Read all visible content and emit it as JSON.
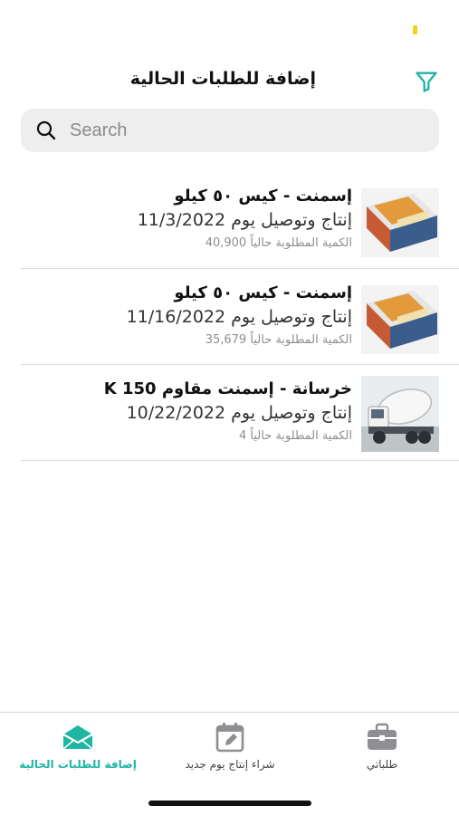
{
  "header": {
    "title": "إضافة للطلبات الحالية"
  },
  "search": {
    "placeholder": "Search",
    "value": ""
  },
  "orders": [
    {
      "title": "إسمنت - كيس ٥٠ كيلو",
      "date_prefix": "إنتاج وتوصيل يوم",
      "date": "11/3/2022",
      "qty_label": "الكمية المطلوبة حالياً",
      "qty": "40,900",
      "image": "cement-bag"
    },
    {
      "title": "إسمنت - كيس ٥٠ كيلو",
      "date_prefix": "إنتاج وتوصيل يوم",
      "date": "11/16/2022",
      "qty_label": "الكمية المطلوبة حالياً",
      "qty": "35,679",
      "image": "cement-bag"
    },
    {
      "title": "خرسانة - إسمنت مقاوم K 150",
      "date_prefix": "إنتاج وتوصيل يوم",
      "date": "10/22/2022",
      "qty_label": "الكمية المطلوبة حالياً",
      "qty": "4",
      "image": "mixer-truck"
    }
  ],
  "tabs": [
    {
      "label": "إضافة للطلبات الحالية",
      "icon": "envelope-open-icon",
      "active": true
    },
    {
      "label": "شراء إنتاج يوم جديد",
      "icon": "calendar-edit-icon",
      "active": false
    },
    {
      "label": "طلباتي",
      "icon": "briefcase-icon",
      "active": false
    }
  ],
  "colors": {
    "accent": "#1fb5a3",
    "status_dot": "#f2d21e",
    "inactive_icon": "#8e8e93"
  }
}
